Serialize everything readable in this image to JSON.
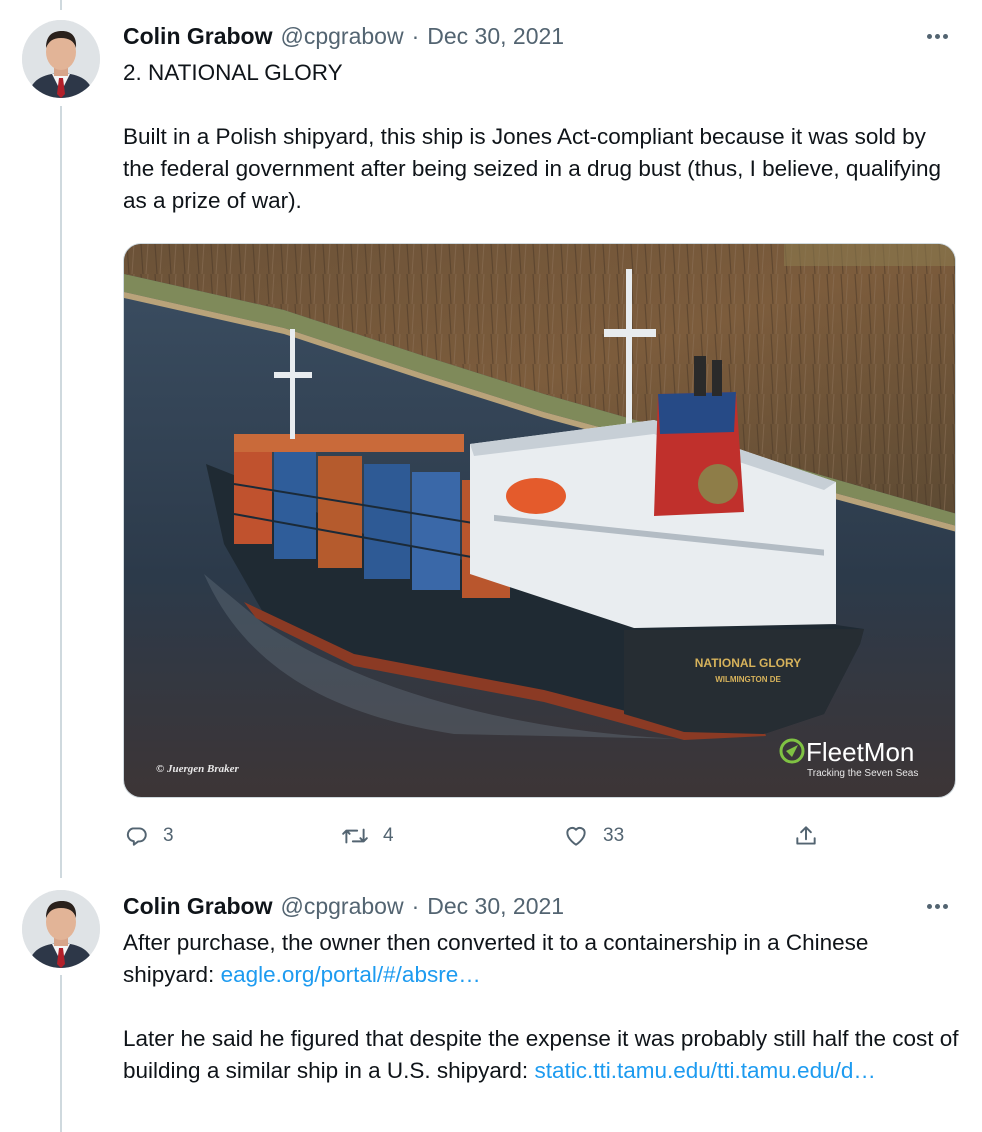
{
  "tweets": [
    {
      "author": {
        "name": "Colin Grabow",
        "handle": "@cpgrabow"
      },
      "separator": "·",
      "date": "Dec 30, 2021",
      "paragraphs": [
        "2. NATIONAL GLORY",
        "Built in a Polish shipyard, this ship is Jones Act-compliant because it was sold by the federal government after being seized in a drug bust (thus, I believe, qualifying as a prize of war)."
      ],
      "media": {
        "ship_name": "NATIONAL GLORY",
        "ship_port": "WILMINGTON DE",
        "photo_credit": "© Juergen Braker",
        "watermark_brand": "FleetMon",
        "watermark_tagline": "Tracking the Seven Seas"
      },
      "stats": {
        "replies": "3",
        "retweets": "4",
        "likes": "33"
      }
    },
    {
      "author": {
        "name": "Colin Grabow",
        "handle": "@cpgrabow"
      },
      "separator": "·",
      "date": "Dec 30, 2021",
      "text1": "After purchase, the owner then converted it to a containership in a Chinese shipyard: ",
      "link1": "eagle.org/portal/#/absre…",
      "text2": "Later he said he figured that despite the expense it was probably still half the cost of building a similar ship in a U.S. shipyard: ",
      "link2": "static.tti.tamu.edu/tti.tamu.edu/d…"
    }
  ],
  "colors": {
    "text": "#0f1419",
    "secondary": "#536471",
    "link": "#1d9bf0",
    "thread_line": "#cfd9de"
  },
  "icons": [
    "reply-icon",
    "retweet-icon",
    "like-icon",
    "share-icon",
    "more-icon",
    "fleetmon-logo-icon"
  ]
}
